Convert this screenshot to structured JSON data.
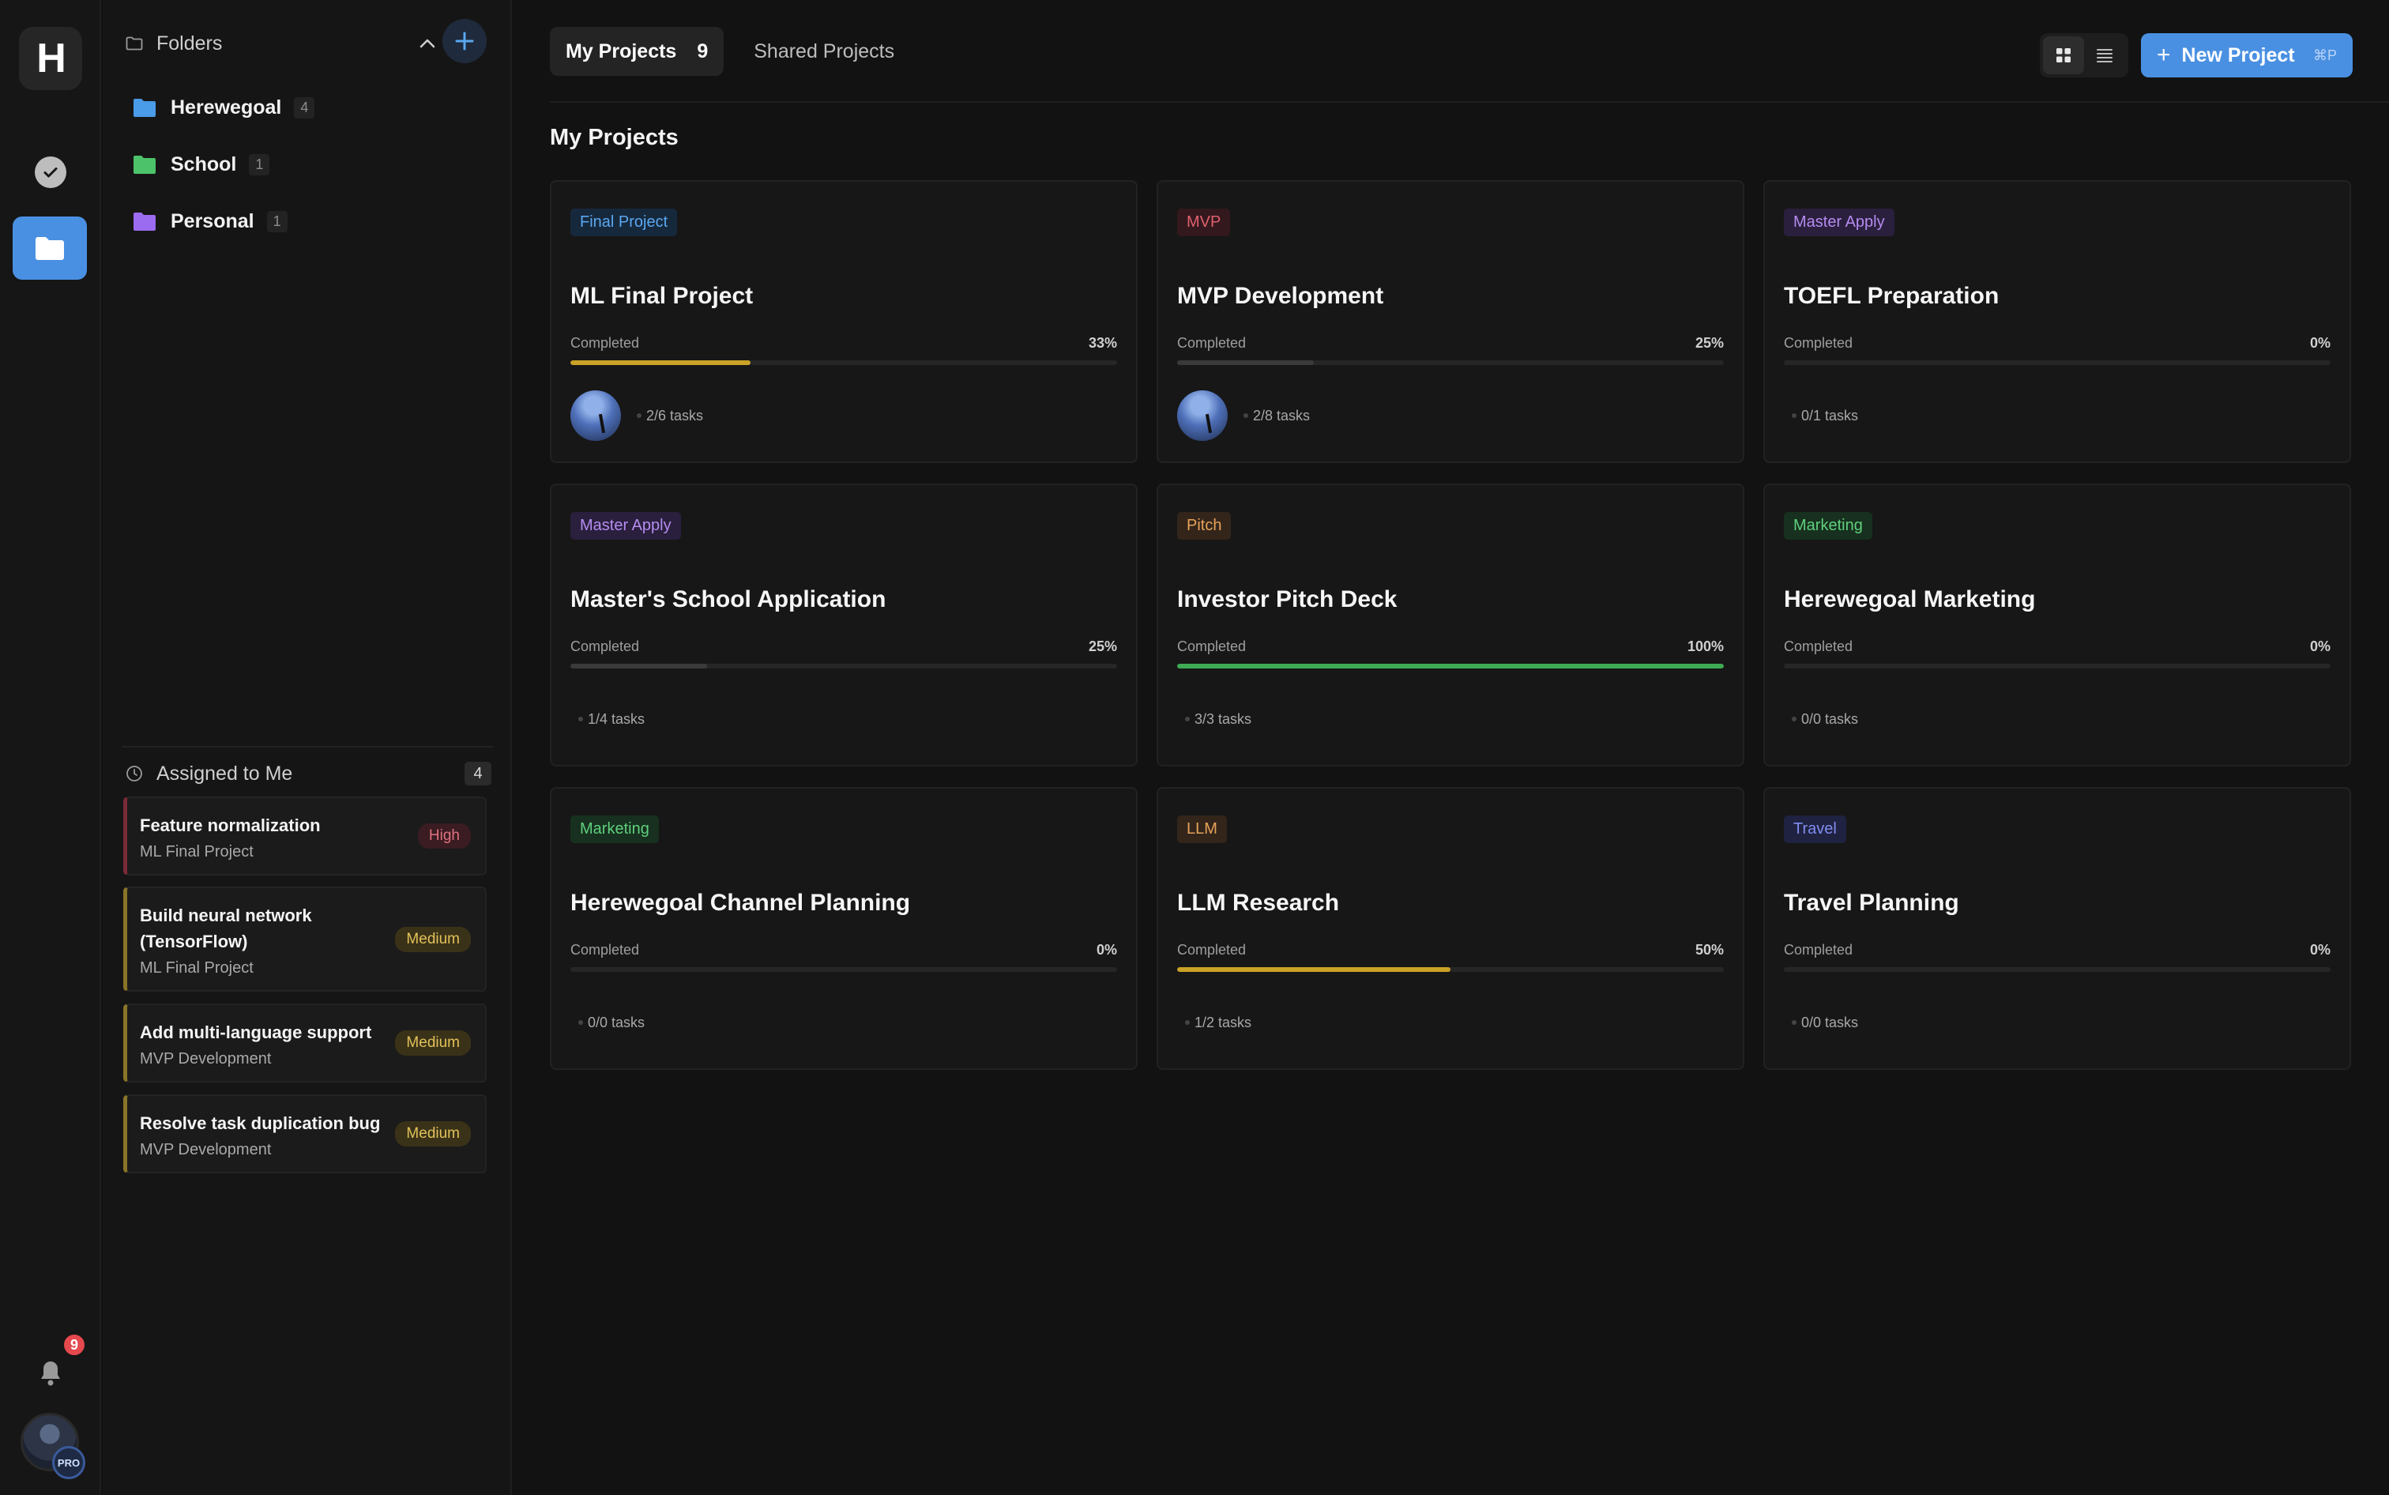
{
  "rail": {
    "logo_letter": "H",
    "notification_count": "9",
    "pro_label": "PRO"
  },
  "sidebar": {
    "folders_title": "Folders",
    "folders": [
      {
        "name": "Herewegoal",
        "count": "4",
        "color": "#4a9be8"
      },
      {
        "name": "School",
        "count": "1",
        "color": "#4cc26a"
      },
      {
        "name": "Personal",
        "count": "1",
        "color": "#9b6cf0"
      }
    ],
    "assigned_title": "Assigned to Me",
    "assigned_count": "4",
    "tasks": [
      {
        "title": "Feature normalization",
        "project": "ML Final Project",
        "priority": "High"
      },
      {
        "title": "Build neural network (TensorFlow)",
        "project": "ML Final Project",
        "priority": "Medium"
      },
      {
        "title": "Add multi-language support",
        "project": "MVP Development",
        "priority": "Medium"
      },
      {
        "title": "Resolve task duplication bug",
        "project": "MVP Development",
        "priority": "Medium"
      }
    ]
  },
  "main": {
    "tabs": [
      {
        "label": "My Projects",
        "count": "9"
      },
      {
        "label": "Shared Projects"
      }
    ],
    "new_project_label": "New Project",
    "new_project_shortcut": "⌘P",
    "section_title": "My Projects",
    "completed_label": "Completed",
    "projects": [
      {
        "tag": "Final Project",
        "tag_color": "#5aa8f0",
        "tag_bg": "#16283c",
        "title": "ML Final Project",
        "percent": "33%",
        "progress": 0.33,
        "bar_color": "#c9a227",
        "tasks": "2/6 tasks",
        "has_avatar": true
      },
      {
        "tag": "MVP",
        "tag_color": "#e0606e",
        "tag_bg": "#33181d",
        "title": "MVP Development",
        "percent": "25%",
        "progress": 0.25,
        "bar_color": "#3a3a3a",
        "tasks": "2/8 tasks",
        "has_avatar": true
      },
      {
        "tag": "Master Apply",
        "tag_color": "#b58cf0",
        "tag_bg": "#2a1f3d",
        "title": "TOEFL Preparation",
        "percent": "0%",
        "progress": 0,
        "bar_color": "#3a3a3a",
        "tasks": "0/1 tasks",
        "has_avatar": false
      },
      {
        "tag": "Master Apply",
        "tag_color": "#b58cf0",
        "tag_bg": "#2a1f3d",
        "title": "Master's School Application",
        "percent": "25%",
        "progress": 0.25,
        "bar_color": "#3a3a3a",
        "tasks": "1/4 tasks",
        "has_avatar": false
      },
      {
        "tag": "Pitch",
        "tag_color": "#e6a25a",
        "tag_bg": "#33251a",
        "title": "Investor Pitch Deck",
        "percent": "100%",
        "progress": 1.0,
        "bar_color": "#3faa56",
        "tasks": "3/3 tasks",
        "has_avatar": false
      },
      {
        "tag": "Marketing",
        "tag_color": "#5fcf7c",
        "tag_bg": "#17301f",
        "title": "Herewegoal Marketing",
        "percent": "0%",
        "progress": 0,
        "bar_color": "#3a3a3a",
        "tasks": "0/0 tasks",
        "has_avatar": false
      },
      {
        "tag": "Marketing",
        "tag_color": "#5fcf7c",
        "tag_bg": "#17301f",
        "title": "Herewegoal Channel Planning",
        "percent": "0%",
        "progress": 0,
        "bar_color": "#3a3a3a",
        "tasks": "0/0 tasks",
        "has_avatar": false
      },
      {
        "tag": "LLM",
        "tag_color": "#e6a25a",
        "tag_bg": "#33251a",
        "title": "LLM Research",
        "percent": "50%",
        "progress": 0.5,
        "bar_color": "#c9a227",
        "tasks": "1/2 tasks",
        "has_avatar": false
      },
      {
        "tag": "Travel",
        "tag_color": "#7f8cf0",
        "tag_bg": "#1f2240",
        "title": "Travel Planning",
        "percent": "0%",
        "progress": 0,
        "bar_color": "#3a3a3a",
        "tasks": "0/0 tasks",
        "has_avatar": false
      }
    ]
  }
}
